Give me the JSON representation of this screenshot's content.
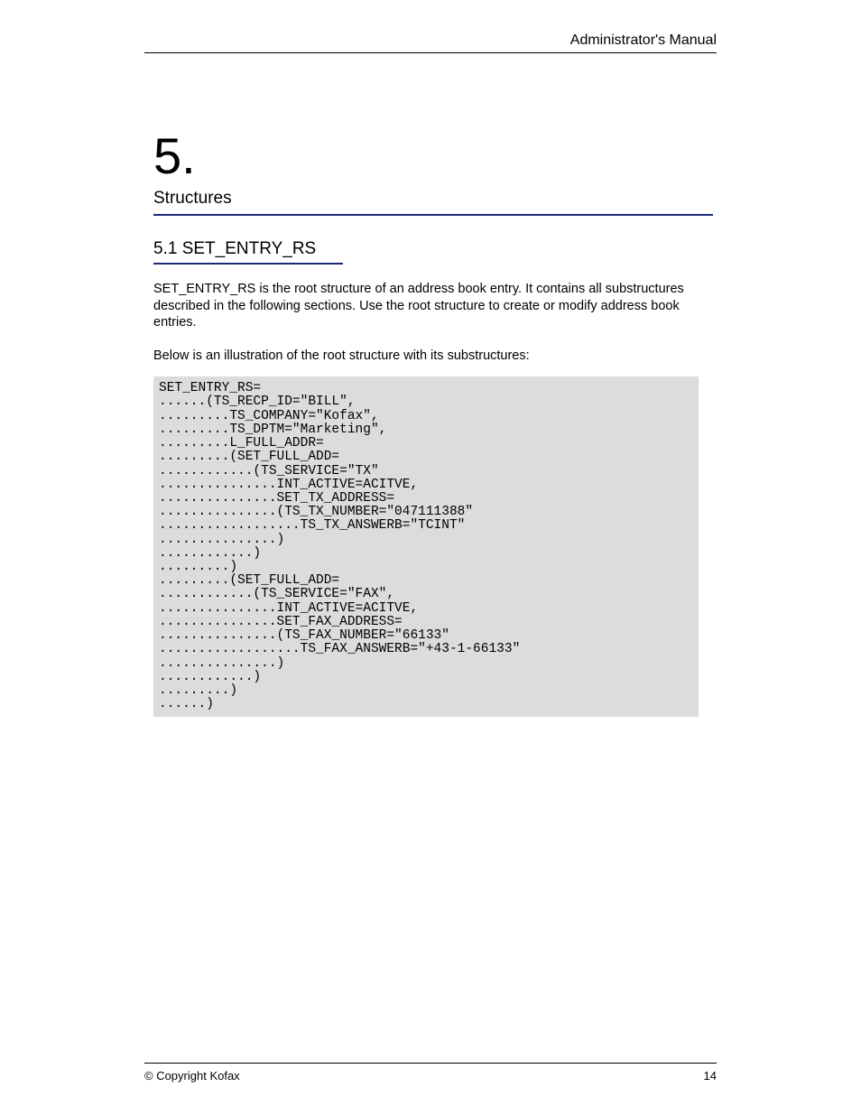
{
  "header": {
    "title": "Administrator's Manual"
  },
  "chapter": {
    "number": "5.",
    "title": "Structures"
  },
  "section": {
    "title": "5.1 SET_ENTRY_RS"
  },
  "body": {
    "p1": "SET_ENTRY_RS is the root structure of an address book entry. It contains all substructures described in the following sections. Use the root structure to create or modify address book entries.",
    "p2": "Below is an illustration of the root structure with its substructures:"
  },
  "code": {
    "l1": "SET_ENTRY_RS=",
    "l2": "......(TS_RECP_ID=\"BILL\",",
    "l3": ".........TS_COMPANY=\"Kofax\",",
    "l4": ".........TS_DPTM=\"Marketing\",",
    "l5": ".........L_FULL_ADDR=",
    "l6": ".........(SET_FULL_ADD=",
    "l7": "............(TS_SERVICE=\"TX\"",
    "l8": "...............INT_ACTIVE=ACITVE,",
    "l9": "...............SET_TX_ADDRESS=",
    "l10": "...............(TS_TX_NUMBER=\"047111388\"",
    "l11": "..................TS_TX_ANSWERB=\"TCINT\"",
    "l12": "...............)",
    "l13": "............)",
    "l14": ".........)",
    "l15": ".........(SET_FULL_ADD=",
    "l16": "............(TS_SERVICE=\"FAX\",",
    "l17": "...............INT_ACTIVE=ACITVE,",
    "l18": "...............SET_FAX_ADDRESS=",
    "l19": "...............(TS_FAX_NUMBER=\"66133\"",
    "l20": "..................TS_FAX_ANSWERB=\"+43-1-66133\"",
    "l21": "...............)",
    "l22": "............)",
    "l23": ".........)",
    "l24": "......)"
  },
  "footer": {
    "copyright": "© Copyright Kofax",
    "page": "14"
  }
}
